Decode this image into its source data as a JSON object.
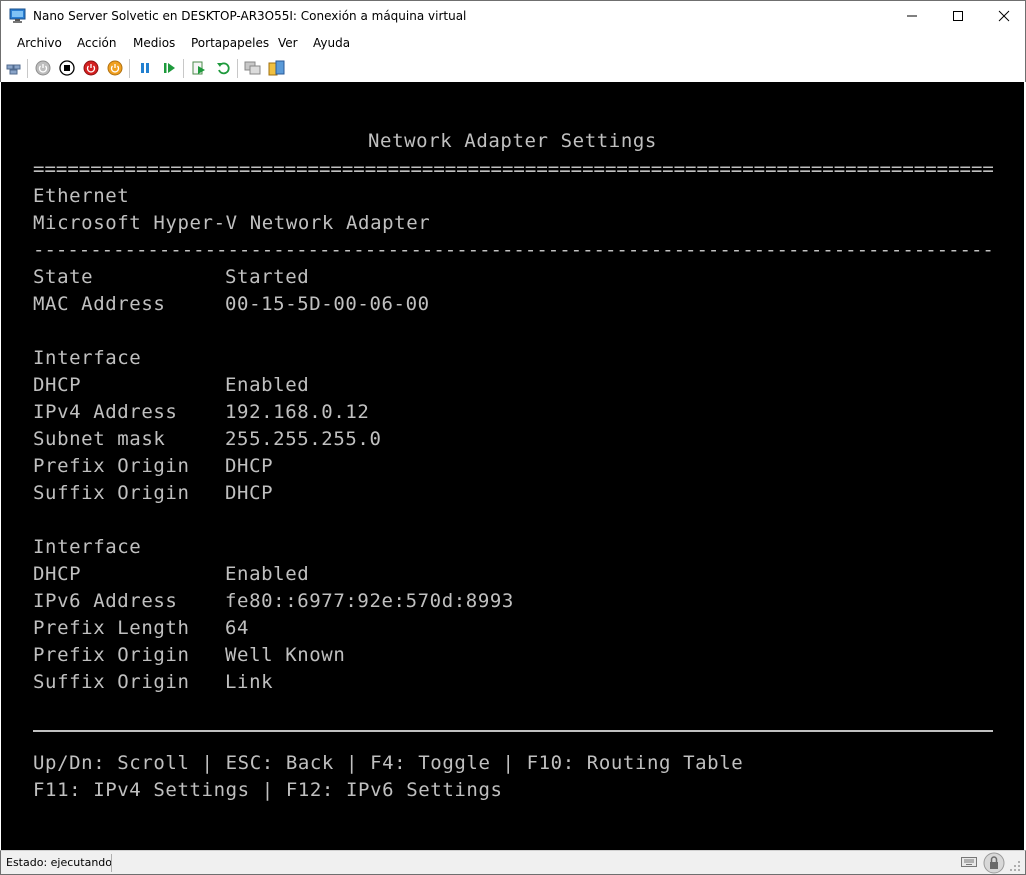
{
  "window": {
    "title": "Nano Server Solvetic en DESKTOP-AR3O55I: Conexión a máquina virtual",
    "minimize": "—",
    "maximize": "☐",
    "close": "✕"
  },
  "menu": [
    "Archivo",
    "Acción",
    "Medios",
    "Portapapeles",
    "Ver",
    "Ayuda"
  ],
  "toolbar": {
    "icons": [
      "ctrl-alt-del-icon",
      "start-icon",
      "turn-off-icon",
      "shutdown-icon",
      "power-icon",
      "pause-icon",
      "resume-icon",
      "checkpoint-icon",
      "revert-icon",
      "enhanced-session-icon",
      "share-icon"
    ]
  },
  "console": {
    "title": "Network Adapter Settings",
    "double_rule": "===========================================================================================",
    "single_rule": "-------------------------------------------------------------------------------------------",
    "adapter_type": "Ethernet",
    "adapter_name": "Microsoft Hyper-V Network Adapter",
    "rows": [
      {
        "label": "State",
        "value": "Started"
      },
      {
        "label": "MAC Address",
        "value": "00-15-5D-00-06-00"
      }
    ],
    "ipv4_interface": {
      "heading": "Interface",
      "rows": [
        {
          "label": "DHCP",
          "value": "Enabled"
        },
        {
          "label": "IPv4 Address",
          "value": "192.168.0.12"
        },
        {
          "label": "Subnet mask",
          "value": "255.255.255.0"
        },
        {
          "label": "Prefix Origin",
          "value": "DHCP"
        },
        {
          "label": "Suffix Origin",
          "value": "DHCP"
        }
      ]
    },
    "ipv6_interface": {
      "heading": "Interface",
      "rows": [
        {
          "label": "DHCP",
          "value": "Enabled"
        },
        {
          "label": "IPv6 Address",
          "value": "fe80::6977:92e:570d:8993"
        },
        {
          "label": "Prefix Length",
          "value": "64"
        },
        {
          "label": "Prefix Origin",
          "value": "Well Known"
        },
        {
          "label": "Suffix Origin",
          "value": "Link"
        }
      ]
    },
    "help_line_1": "Up/Dn: Scroll | ESC: Back | F4: Toggle | F10: Routing Table",
    "help_line_2": "F11: IPv4 Settings | F12: IPv6 Settings"
  },
  "status": {
    "text": "Estado: ejecutando"
  },
  "colors": {
    "console_bg": "#000000",
    "console_fg": "#c0c0c0"
  }
}
